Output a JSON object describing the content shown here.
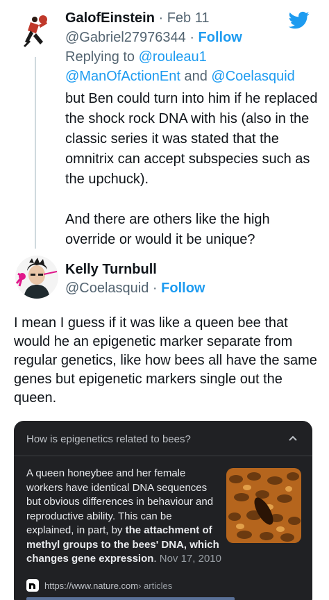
{
  "tweet1": {
    "display_name": "GalofEinstein",
    "separator": " · ",
    "date": "Feb 11",
    "handle": "@Gabriel27976344",
    "follow_label": "Follow",
    "replying_prefix": "Replying to ",
    "mention1": "@rouleau1",
    "mention2": "@ManOfActionEnt",
    "and_text": " and ",
    "mention3": "@Coelasquid",
    "body": "but Ben could turn into him if he replaced the shock rock DNA with his (also in the classic series it was stated that the omnitrix can accept subspecies such as the upchuck).\n\n And there are others like the high override or would it be unique?"
  },
  "tweet2": {
    "display_name": "Kelly Turnbull",
    "handle": "@Coelasquid",
    "separator": " · ",
    "follow_label": "Follow",
    "body": "I mean I guess if it was like a queen bee that would he an epigenetic marker separate from regular genetics, like how bees all have the same genes but epigenetic markers single out the queen."
  },
  "card": {
    "question": "How is epigenetics related to bees?",
    "text_plain": "A queen honeybee and her female workers have identical DNA sequences but obvious differences in behaviour and reproductive ability. This can be explained, in part, by ",
    "text_bold": "the attachment of methyl groups to the bees' DNA, which changes gene expression",
    "text_end": ". ",
    "date": "Nov 17, 2010",
    "source_url": "https://www.nature.com",
    "source_crumb": " › articles"
  },
  "icons": {
    "logo": "twitter-bird-icon",
    "chevron": "chevron-up-icon",
    "favicon": "nature-favicon-icon"
  },
  "colors": {
    "accent": "#1d9bf0",
    "text": "#0f1419",
    "muted": "#536471",
    "card_bg": "#202124"
  }
}
